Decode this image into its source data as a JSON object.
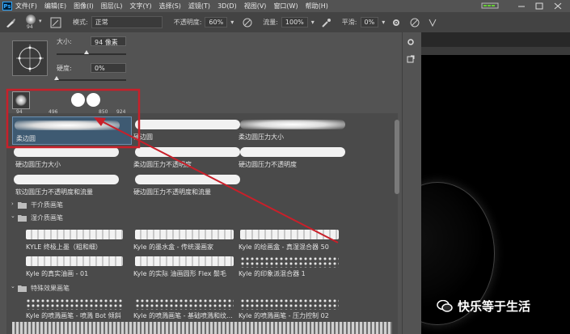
{
  "app": {
    "logo_text": "Ps"
  },
  "menu": [
    {
      "label": "文件(F)"
    },
    {
      "label": "编辑(E)"
    },
    {
      "label": "图像(I)"
    },
    {
      "label": "图层(L)"
    },
    {
      "label": "文字(Y)"
    },
    {
      "label": "选择(S)"
    },
    {
      "label": "滤镜(T)"
    },
    {
      "label": "3D(D)"
    },
    {
      "label": "视图(V)"
    },
    {
      "label": "窗口(W)"
    },
    {
      "label": "帮助(H)"
    }
  ],
  "options": {
    "size_value": "94",
    "mode_label": "模式:",
    "mode_value": "正常",
    "opacity_label": "不透明度:",
    "opacity_value": "60%",
    "flow_label": "流量:",
    "flow_value": "100%",
    "smooth_label": "平滑:",
    "smooth_value": "0%"
  },
  "brush_panel": {
    "size_label": "大小:",
    "size_value": "94 像素",
    "hardness_label": "硬度:",
    "hardness_value": "0%",
    "recent_presets": [
      {
        "size": "94"
      },
      {
        "size": "496"
      },
      {
        "size": "850"
      },
      {
        "size": "924"
      }
    ]
  },
  "brushes": {
    "general": [
      {
        "name": "柔边圆",
        "style": "soft",
        "selected": true
      },
      {
        "name": "硬边圆",
        "style": "hard"
      },
      {
        "name": "柔边圆压力大小",
        "style": "soft"
      },
      {
        "name": "硬边圆压力大小",
        "style": "hard"
      },
      {
        "name": "柔边圆压力不透明度",
        "style": "hard"
      },
      {
        "name": "硬边圆压力不透明度",
        "style": "hard"
      },
      {
        "name": "软边圆压力不透明度和流量",
        "style": "hard"
      },
      {
        "name": "硬边圆压力不透明度和流量",
        "style": "hard"
      }
    ],
    "groups": [
      {
        "label": "干介质画笔"
      },
      {
        "label": "湿介质画笔"
      },
      {
        "label": "特殊效果画笔"
      }
    ],
    "wet": [
      {
        "name": "KYLE 终极上墨（粗和细）",
        "style": "rough"
      },
      {
        "name": "Kyle 的墨水盒 - 传统漫画家",
        "style": "rough"
      },
      {
        "name": "Kyle 的绘画盒 - 真湿混合器 50",
        "style": "rough"
      },
      {
        "name": "Kyle 的真实油画 - 01",
        "style": "rough"
      },
      {
        "name": "Kyle 的实际 油画圆形 Flex 鬃毛",
        "style": "rough"
      },
      {
        "name": "Kyle 的印象派混合器 1",
        "style": "dots"
      }
    ],
    "special": [
      {
        "name": "Kyle 的喷溅画笔 - 喷溅 Bot 倾斜",
        "style": "dots"
      },
      {
        "name": "Kyle 的喷溅画笔 - 基础喷溅和纹...",
        "style": "dots"
      },
      {
        "name": "Kyle 的喷溅画笔 - 压力控制 02",
        "style": "dots"
      }
    ]
  },
  "watermark": {
    "text": "快乐等于生活"
  },
  "colors": {
    "annotation_red": "#c8202a",
    "panel_bg": "#535353",
    "canvas_bg": "#000000"
  }
}
